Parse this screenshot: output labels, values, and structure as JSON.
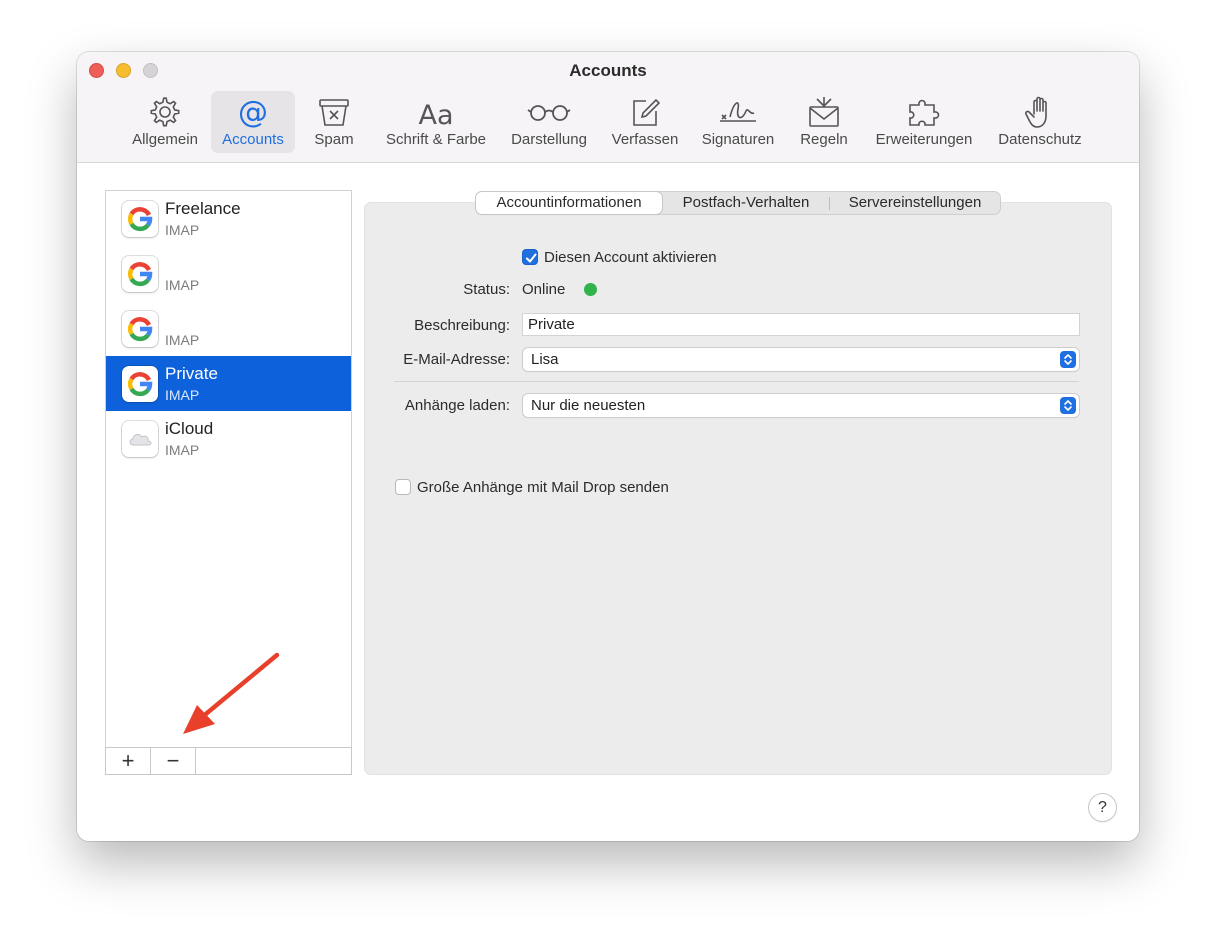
{
  "window": {
    "title": "Accounts"
  },
  "toolbar": [
    {
      "label": "Allgemein",
      "icon": "gear-icon",
      "active": false
    },
    {
      "label": "Accounts",
      "icon": "at-sign-icon",
      "active": true
    },
    {
      "label": "Spam",
      "icon": "spam-bin-icon",
      "active": false
    },
    {
      "label": "Schrift & Farbe",
      "icon": "font-aa-icon",
      "glyph": "Aa",
      "active": false
    },
    {
      "label": "Darstellung",
      "icon": "glasses-icon",
      "active": false
    },
    {
      "label": "Verfassen",
      "icon": "compose-icon",
      "active": false
    },
    {
      "label": "Signaturen",
      "icon": "signature-icon",
      "active": false
    },
    {
      "label": "Regeln",
      "icon": "rules-envelope-icon",
      "active": false
    },
    {
      "label": "Erweiterungen",
      "icon": "puzzle-icon",
      "active": false
    },
    {
      "label": "Datenschutz",
      "icon": "hand-icon",
      "active": false
    }
  ],
  "accounts": [
    {
      "name": "Freelance",
      "type": "IMAP",
      "logo": "google-icon",
      "selected": false
    },
    {
      "name": "",
      "type": "IMAP",
      "logo": "google-icon",
      "selected": false
    },
    {
      "name": "",
      "type": "IMAP",
      "logo": "google-icon",
      "selected": false
    },
    {
      "name": "Private",
      "type": "IMAP",
      "logo": "google-icon",
      "selected": true
    },
    {
      "name": "iCloud",
      "type": "IMAP",
      "logo": "icloud-icon",
      "selected": false
    }
  ],
  "list_buttons": {
    "add": "+",
    "remove": "−"
  },
  "tabs": [
    {
      "label": "Accountinformationen",
      "active": true
    },
    {
      "label": "Postfach-Verhalten",
      "active": false
    },
    {
      "label": "Servereinstellungen",
      "active": false
    }
  ],
  "form": {
    "enable_account": {
      "label": "Diesen Account aktivieren",
      "checked": true
    },
    "status": {
      "label": "Status:",
      "value": "Online",
      "color": "#2fb34a"
    },
    "description": {
      "label": "Beschreibung:",
      "value": "Private"
    },
    "email": {
      "label": "E-Mail-Adresse:",
      "value": "Lisa"
    },
    "attachments": {
      "label": "Anhänge laden:",
      "value": "Nur die neuesten"
    },
    "mail_drop": {
      "label": "Große Anhänge mit Mail Drop senden",
      "checked": false
    }
  },
  "help": {
    "label": "?"
  },
  "colors": {
    "accent": "#1f6fe0",
    "selection": "#0d62dc",
    "annotation": "#e8402a"
  }
}
